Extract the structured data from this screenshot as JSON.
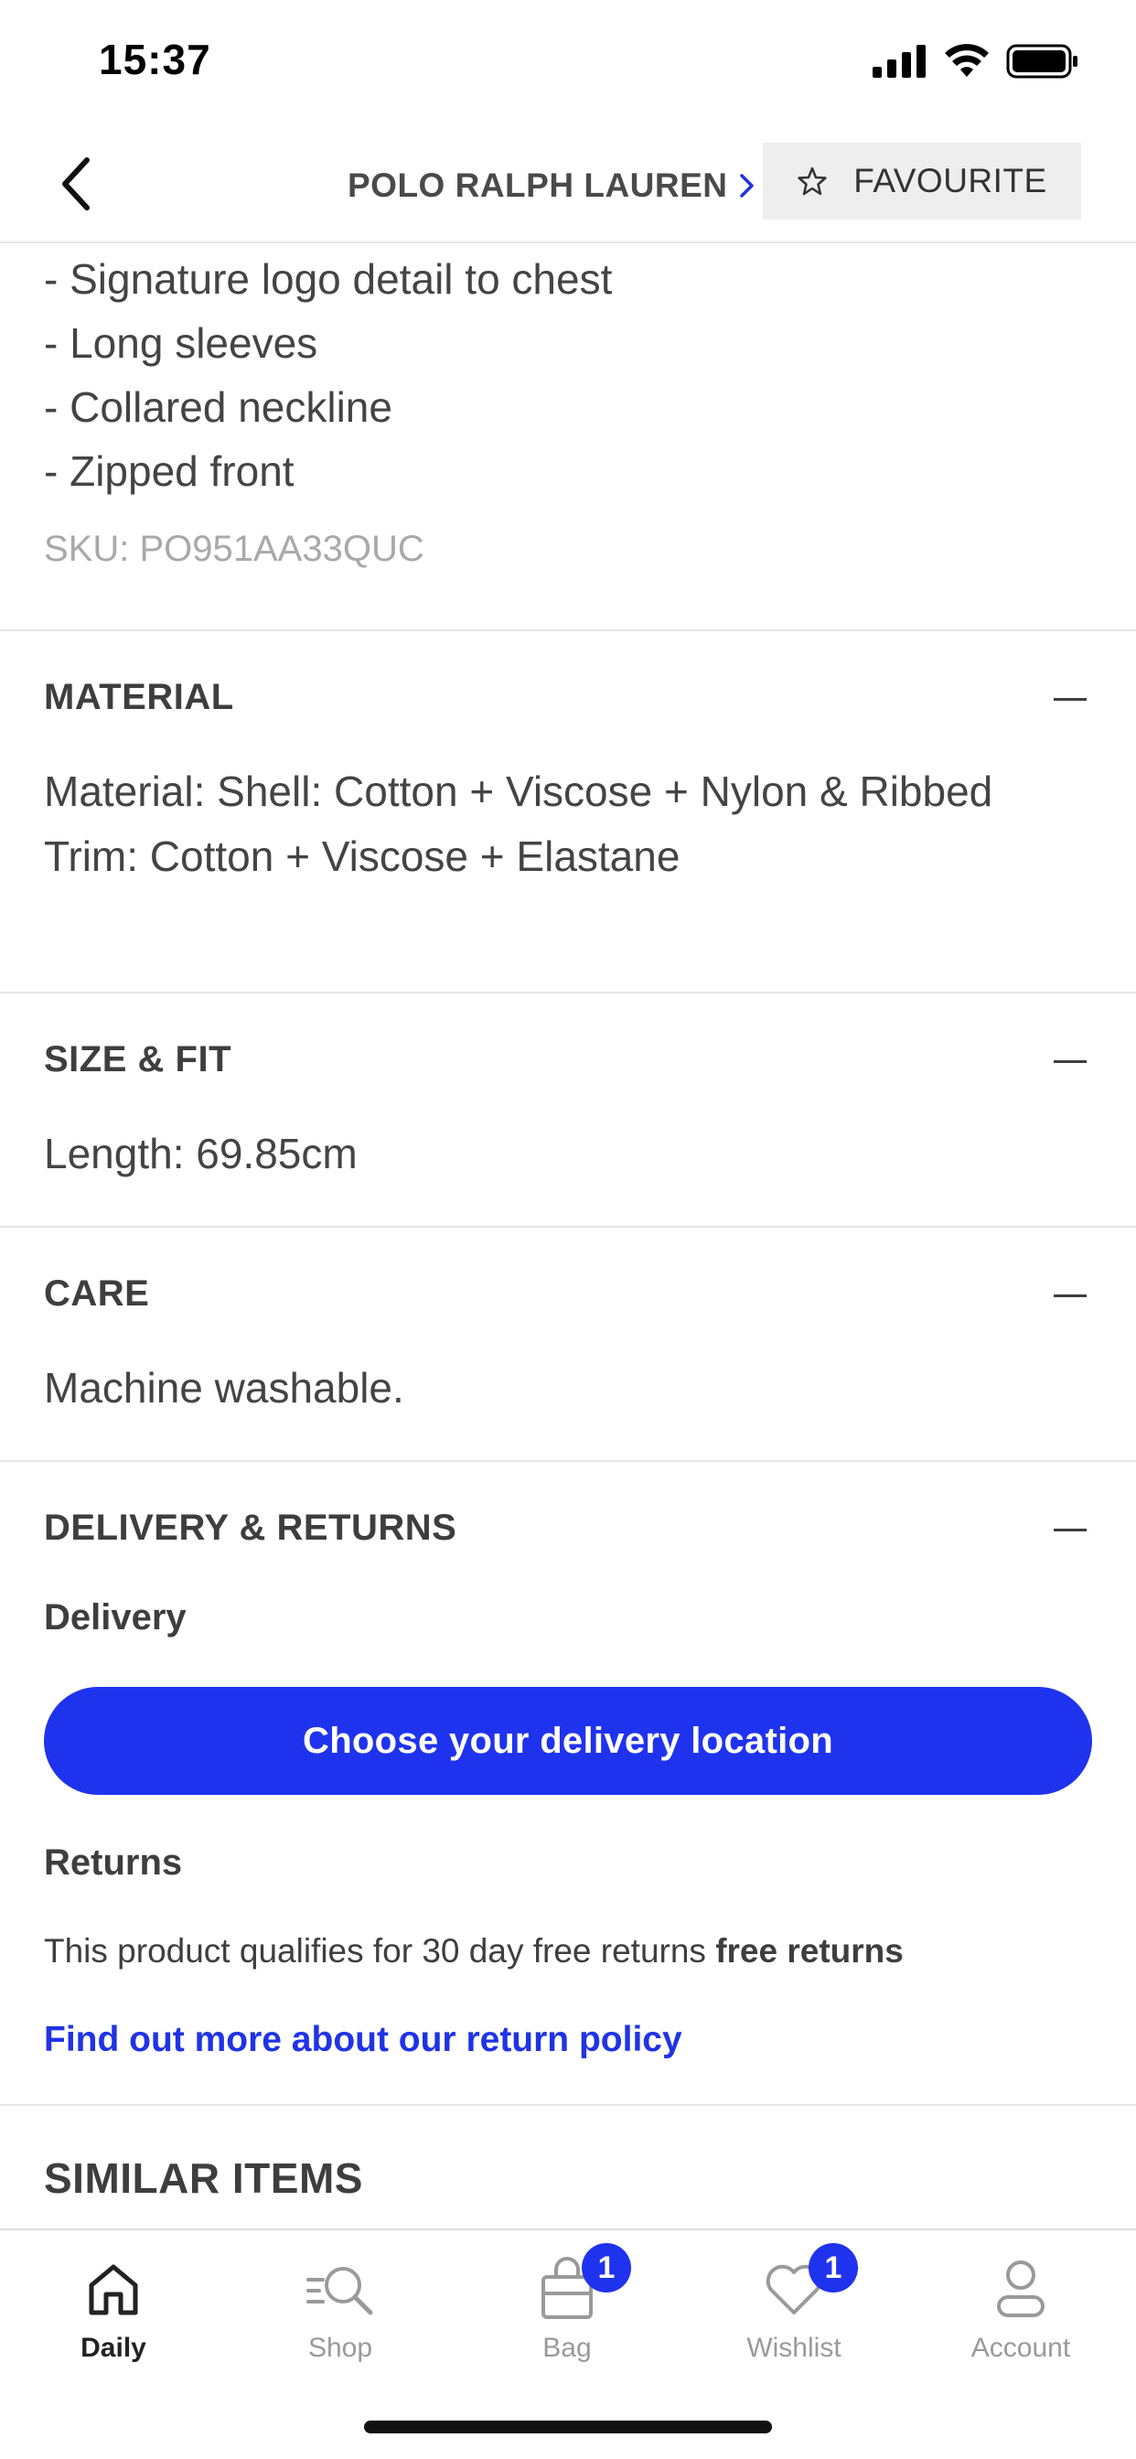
{
  "status_bar": {
    "time": "15:37"
  },
  "top_nav": {
    "brand": "POLO RALPH LAUREN",
    "favourite_label": "FAVOURITE"
  },
  "details": {
    "bullets": [
      "- Signature logo detail to chest",
      "- Long sleeves",
      "- Collared neckline",
      "- Zipped front"
    ],
    "sku": "SKU: PO951AA33QUC"
  },
  "material": {
    "title": "MATERIAL",
    "text": "Material: Shell: Cotton + Viscose + Nylon & Ribbed Trim: Cotton + Viscose + Elastane"
  },
  "size_fit": {
    "title": "SIZE & FIT",
    "text": "Length: 69.85cm"
  },
  "care": {
    "title": "CARE",
    "text": "Machine washable."
  },
  "delivery_returns": {
    "title": "DELIVERY & RETURNS",
    "delivery_heading": "Delivery",
    "delivery_button": "Choose your delivery location",
    "returns_heading": "Returns",
    "returns_text": "This product qualifies for 30 day free returns",
    "returns_bold": "free returns",
    "return_link": "Find out more about our return policy"
  },
  "similar": {
    "title": "SIMILAR ITEMS"
  },
  "tab_bar": {
    "tabs": [
      {
        "label": "Daily",
        "icon": "home-icon",
        "badge": ""
      },
      {
        "label": "Shop",
        "icon": "search-icon",
        "badge": ""
      },
      {
        "label": "Bag",
        "icon": "bag-icon",
        "badge": "1"
      },
      {
        "label": "Wishlist",
        "icon": "heart-icon",
        "badge": "1"
      },
      {
        "label": "Account",
        "icon": "person-icon",
        "badge": ""
      }
    ]
  },
  "colors": {
    "accent": "#1f33ee",
    "link": "#1f33e6",
    "text": "#3e3e3e",
    "muted": "#a9a9a9"
  }
}
